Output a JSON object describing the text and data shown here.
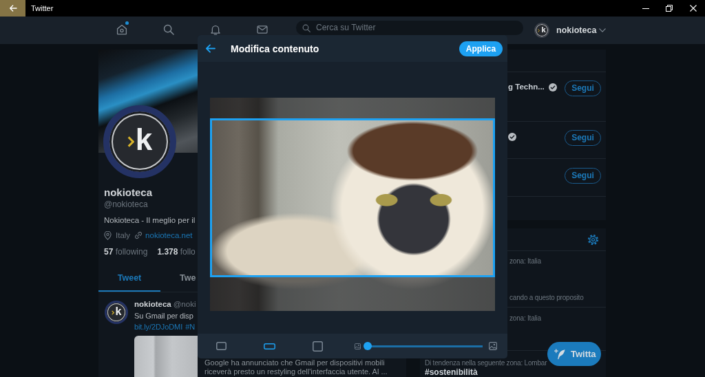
{
  "window": {
    "title": "Twitter"
  },
  "nav": {
    "items": [
      {
        "kind": "home",
        "new": true
      },
      {
        "kind": "search",
        "new": false
      },
      {
        "kind": "notifications",
        "new": false
      },
      {
        "kind": "messages",
        "new": false
      }
    ],
    "search": {
      "placeholder": "Cerca su Twitter"
    },
    "account": {
      "avatar_letter": "k",
      "name": "nokioteca"
    }
  },
  "profile": {
    "avatar_letter": "k",
    "name": "nokioteca",
    "handle": "@nokioteca",
    "bio": "Nokioteca - Il meglio per il",
    "location": "Italy",
    "website": "nokioteca.net",
    "stats": [
      "**57** following",
      "**1.378** follo"
    ],
    "tabs": [
      {
        "label": "Tweet",
        "selected": true
      },
      {
        "label": "Twe",
        "selected": false
      }
    ],
    "tweet": {
      "avatar_letter": "k",
      "author": "nokioteca",
      "handle": "@noki",
      "text": "Su Gmail per disp",
      "links": [
        "bit.ly/2DJoDMI",
        "#N"
      ],
      "card_text": "Google ha annunciato che Gmail per dispositivi mobili riceverà presto un restyling dell'interfaccia utente. Al ..."
    }
  },
  "who_to_follow": {
    "rows": [
      {
        "name": "g Techn...",
        "verified": true,
        "button": "Segui"
      },
      {
        "verified": true,
        "button": "Segui"
      },
      {
        "verified": false,
        "button": "Segui"
      }
    ]
  },
  "trends": {
    "items": [
      {
        "context": "zona: Italia",
        "detail": "cando a questo proposito"
      },
      {
        "context": "zona: Italia"
      },
      {
        "context": "Di tendenza nella seguente zona: Lombar",
        "name": "#sostenibilità"
      }
    ]
  },
  "compose_button": {
    "label": "Twitta"
  },
  "modal": {
    "title": "Modifica contenuto",
    "apply_label": "Applica",
    "aspect_options": [
      {
        "kind": "original",
        "selected": false
      },
      {
        "kind": "wide",
        "selected": true
      },
      {
        "kind": "square",
        "selected": false
      }
    ],
    "zoom": {
      "level": 0
    }
  }
}
